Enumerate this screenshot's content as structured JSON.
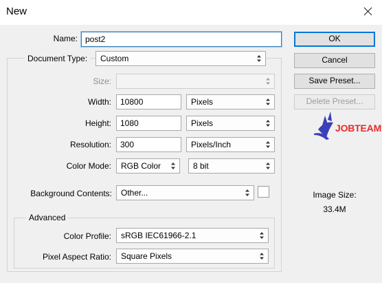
{
  "window": {
    "title": "New",
    "close_icon": "close-icon"
  },
  "form": {
    "name": {
      "label": "Name:",
      "value": "post2"
    },
    "document_type": {
      "label": "Document Type:",
      "value": "Custom"
    },
    "size": {
      "label": "Size:",
      "value": ""
    },
    "width": {
      "label": "Width:",
      "value": "10800",
      "unit": "Pixels"
    },
    "height": {
      "label": "Height:",
      "value": "1080",
      "unit": "Pixels"
    },
    "resolution": {
      "label": "Resolution:",
      "value": "300",
      "unit": "Pixels/Inch"
    },
    "color_mode": {
      "label": "Color Mode:",
      "value": "RGB Color",
      "depth": "8 bit"
    },
    "background_contents": {
      "label": "Background Contents:",
      "value": "Other...",
      "swatch_color": "#ffffff"
    },
    "advanced": {
      "legend": "Advanced",
      "color_profile": {
        "label": "Color Profile:",
        "value": "sRGB IEC61966-2.1"
      },
      "pixel_aspect_ratio": {
        "label": "Pixel Aspect Ratio:",
        "value": "Square Pixels"
      }
    }
  },
  "buttons": {
    "ok": "OK",
    "cancel": "Cancel",
    "save_preset": "Save Preset...",
    "delete_preset": "Delete Preset..."
  },
  "logo": {
    "text": "JOBTEAM",
    "colors": {
      "book": "#3b3fb8",
      "text": "#e82a2a"
    }
  },
  "image_size": {
    "label": "Image Size:",
    "value": "33.4M"
  }
}
